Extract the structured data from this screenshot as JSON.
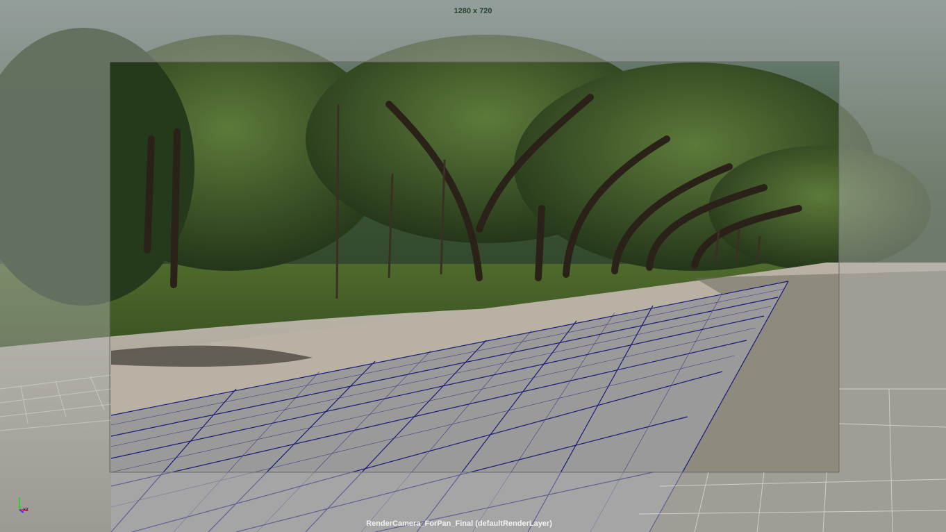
{
  "viewport": {
    "resolution_label": "1280 x 720",
    "camera_label": "RenderCamera_ForPan_Final (defaultRenderLayer)",
    "axis_label": "xz"
  },
  "colors": {
    "resolution_text": "#24452f",
    "camera_text": "#f2f2f2",
    "grid_line": "#1a1a7a",
    "plane_fill": "#9a9a9a",
    "gate_mask": "#b4b4b4",
    "axis_y": "#2ad12a",
    "axis_x": "#e33",
    "axis_z": "#3a3aff"
  }
}
